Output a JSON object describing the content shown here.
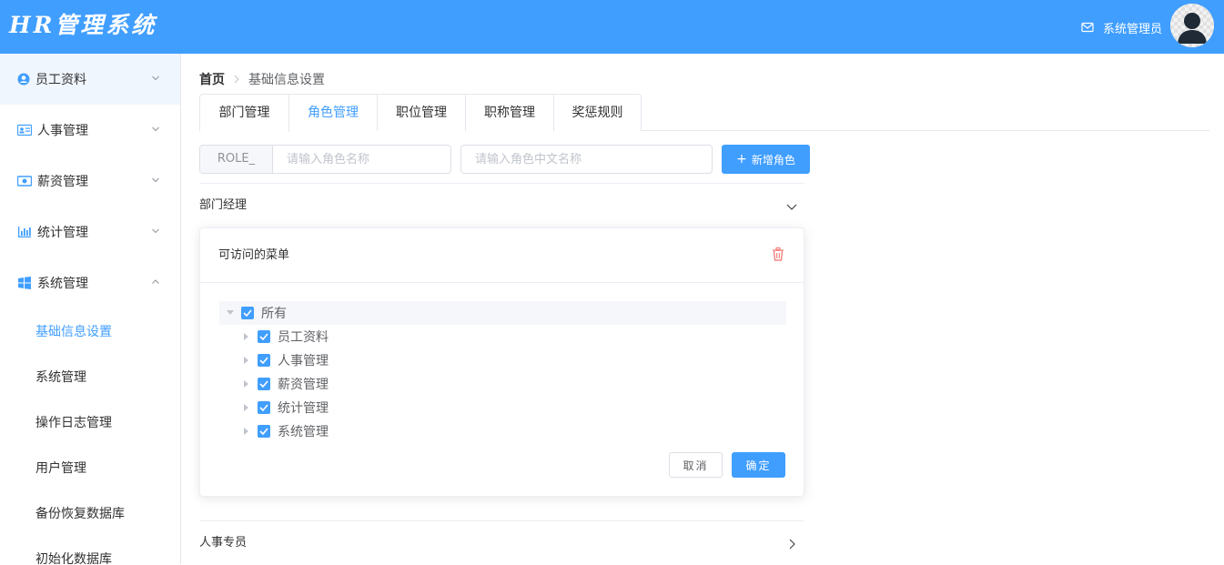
{
  "app": {
    "logo": "HR管理系统"
  },
  "header": {
    "user_name": "系统管理员",
    "icons": [
      "mail-icon",
      "avatar"
    ]
  },
  "sidebar": {
    "menus": [
      {
        "label": "员工资料",
        "icon": "user-circle-icon",
        "expanded": false
      },
      {
        "label": "人事管理",
        "icon": "id-card-icon",
        "expanded": false
      },
      {
        "label": "薪资管理",
        "icon": "money-icon",
        "expanded": false
      },
      {
        "label": "统计管理",
        "icon": "bar-chart-icon",
        "expanded": false
      },
      {
        "label": "系统管理",
        "icon": "windows-icon",
        "expanded": true
      }
    ],
    "sub_items": [
      {
        "label": "基础信息设置",
        "active": true
      },
      {
        "label": "系统管理",
        "active": false
      },
      {
        "label": "操作日志管理",
        "active": false
      },
      {
        "label": "用户管理",
        "active": false
      },
      {
        "label": "备份恢复数据库",
        "active": false
      },
      {
        "label": "初始化数据库",
        "active": false
      }
    ]
  },
  "breadcrumb": {
    "home": "首页",
    "current": "基础信息设置"
  },
  "tabs": [
    {
      "label": "部门管理",
      "active": false
    },
    {
      "label": "角色管理",
      "active": true
    },
    {
      "label": "职位管理",
      "active": false
    },
    {
      "label": "职称管理",
      "active": false
    },
    {
      "label": "奖惩规则",
      "active": false
    }
  ],
  "toolbar": {
    "role_prefix": "ROLE_",
    "role_name_placeholder": "请输入角色名称",
    "role_zh_placeholder": "请输入角色中文名称",
    "add_button": "新增角色"
  },
  "roles": [
    {
      "name": "部门经理",
      "expanded": true,
      "card_title": "可访问的菜单",
      "tree": {
        "root": {
          "label": "所有",
          "checked": true,
          "expanded": true
        },
        "children": [
          {
            "label": "员工资料",
            "checked": true
          },
          {
            "label": "人事管理",
            "checked": true
          },
          {
            "label": "薪资管理",
            "checked": true
          },
          {
            "label": "统计管理",
            "checked": true
          },
          {
            "label": "系统管理",
            "checked": true
          }
        ]
      },
      "cancel_button": "取消",
      "confirm_button": "确定"
    },
    {
      "name": "人事专员",
      "expanded": false
    }
  ],
  "colors": {
    "primary": "#409eff",
    "danger": "#f56c6c",
    "text": "#303133"
  }
}
